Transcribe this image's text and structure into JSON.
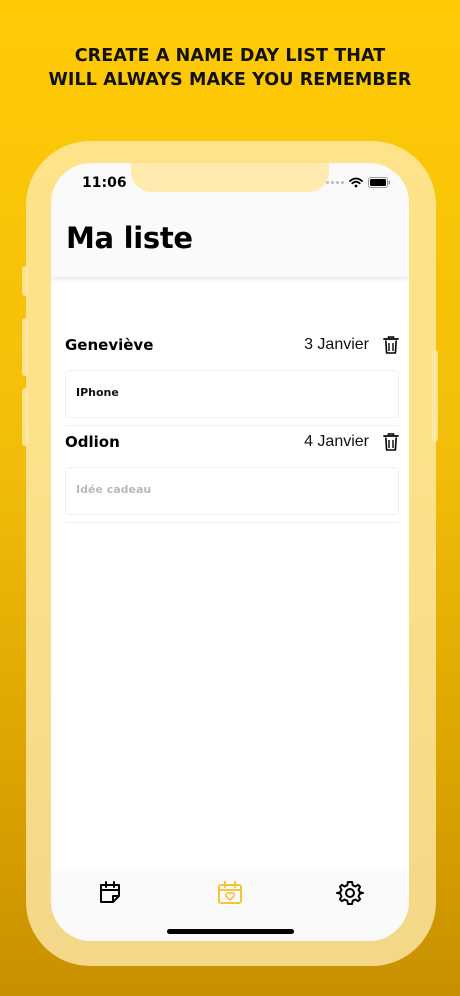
{
  "headline": {
    "line1": "CREATE A NAME DAY LIST THAT",
    "line2": "WILL ALWAYS MAKE YOU REMEMBER"
  },
  "status_bar": {
    "time": "11:06",
    "icons": [
      "signal-dots-icon",
      "wifi-icon",
      "battery-icon"
    ]
  },
  "nav": {
    "title": "Ma liste"
  },
  "entries": [
    {
      "name": "Geneviève",
      "date": "3 Janvier",
      "gift_value": "IPhone",
      "gift_placeholder": "Idée cadeau"
    },
    {
      "name": "Odlion",
      "date": "4 Janvier",
      "gift_value": "",
      "gift_placeholder": "Idée cadeau"
    }
  ],
  "tabbar": {
    "tabs": [
      {
        "icon": "calendar-note-icon",
        "active": false
      },
      {
        "icon": "calendar-heart-icon",
        "active": true
      },
      {
        "icon": "gear-icon",
        "active": false
      }
    ]
  },
  "colors": {
    "background": "#FFCB05",
    "accent_tab": "#F5C33B",
    "text": "#000000"
  }
}
